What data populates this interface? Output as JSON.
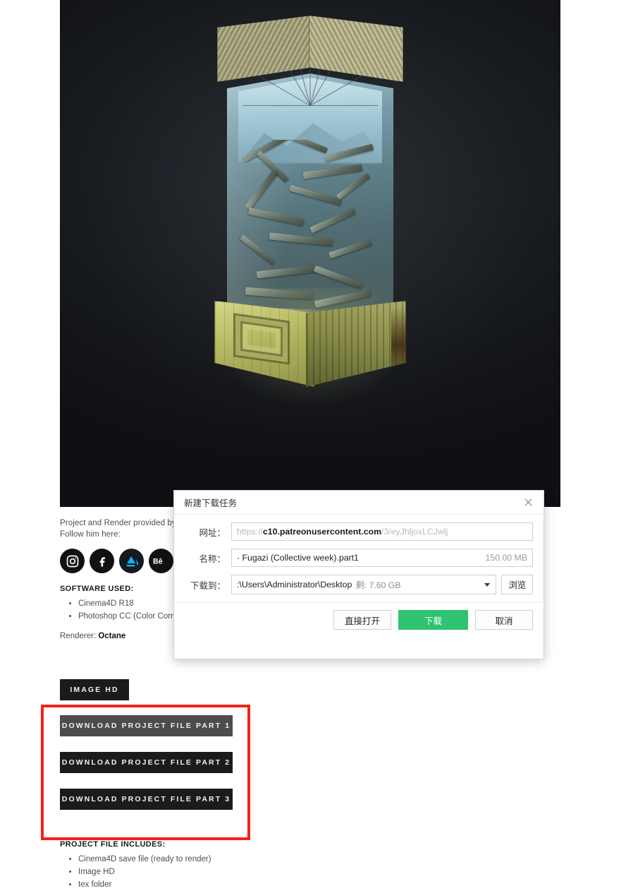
{
  "page": {
    "credit_line_1": "Project and Render provided by",
    "credit_line_2": "Follow him here:",
    "socials": [
      {
        "name": "instagram",
        "label": "Instagram"
      },
      {
        "name": "facebook",
        "label": "Facebook"
      },
      {
        "name": "artstation",
        "label": "ArtStation"
      },
      {
        "name": "behance",
        "label": "Behance"
      }
    ],
    "software_heading": "SOFTWARE USED:",
    "software_items": [
      "Cinema4D R18",
      "Photoshop CC (Color Corre"
    ],
    "renderer_label": "Renderer: ",
    "renderer_value": "Octane",
    "buttons": {
      "image_hd": "IMAGE HD",
      "part1": "DOWNLOAD PROJECT FILE PART 1",
      "part2": "DOWNLOAD PROJECT FILE PART 2",
      "part3": "DOWNLOAD PROJECT FILE PART 3"
    },
    "includes_heading": "PROJECT FILE INCLUDES:",
    "includes_items": [
      "Cinema4D save file (ready to render)",
      "Image HD",
      "tex folder"
    ],
    "highlight_color": "#f32119"
  },
  "dialog": {
    "title": "新建下载任务",
    "close_icon": "close-icon",
    "url_label": "网址：",
    "url_scheme": "https://",
    "url_host": "c10.patreonusercontent.com",
    "url_path": "/3/eyJhljoxLCJwlj",
    "name_label": "名称：",
    "file_name": "· Fugazi (Collective week).part1",
    "file_size": "150.00 MB",
    "path_label": "下载到：",
    "save_path": ":\\Users\\Administrator\\Desktop",
    "free_space": "剩: 7.60 GB",
    "browse_label": "浏览",
    "open_label": "直接打开",
    "download_label": "下载",
    "cancel_label": "取消",
    "accent_color": "#2fc271"
  }
}
